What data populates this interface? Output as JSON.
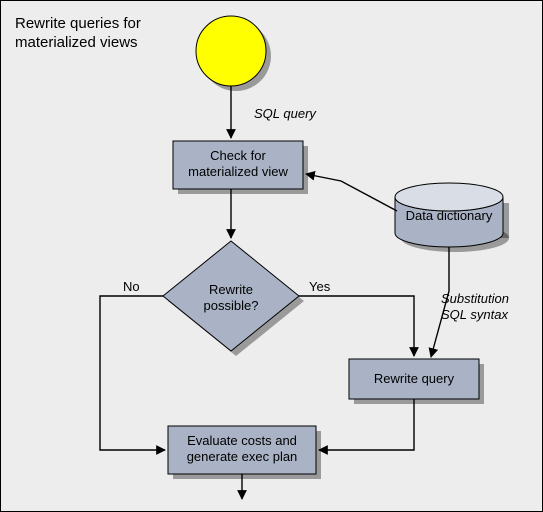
{
  "title": "Rewrite queries for\nmaterialized views",
  "nodes": {
    "start": {
      "name": "start-node"
    },
    "check": {
      "label": "Check for\nmaterialized view"
    },
    "decision": {
      "label": "Rewrite\npossible?"
    },
    "rewrite": {
      "label": "Rewrite query"
    },
    "evaluate": {
      "label": "Evaluate costs and\ngenerate exec plan"
    },
    "dict": {
      "label": "Data dictionary"
    }
  },
  "edges": {
    "sql_query": {
      "label": "SQL query"
    },
    "substitution": {
      "label": "Substitution\nSQL syntax"
    },
    "yes": {
      "label": "Yes"
    },
    "no": {
      "label": "No"
    }
  },
  "chart_data": {
    "type": "diagram",
    "title": "Rewrite queries for materialized views",
    "nodes": [
      {
        "id": "start",
        "type": "start",
        "label": ""
      },
      {
        "id": "check",
        "type": "process",
        "label": "Check for materialized view"
      },
      {
        "id": "decision",
        "type": "decision",
        "label": "Rewrite possible?"
      },
      {
        "id": "rewrite",
        "type": "process",
        "label": "Rewrite query"
      },
      {
        "id": "evaluate",
        "type": "process",
        "label": "Evaluate costs and generate exec plan"
      },
      {
        "id": "dict",
        "type": "datastore",
        "label": "Data dictionary"
      },
      {
        "id": "end",
        "type": "end",
        "label": ""
      }
    ],
    "edges": [
      {
        "from": "start",
        "to": "check",
        "label": "SQL query"
      },
      {
        "from": "check",
        "to": "decision",
        "label": ""
      },
      {
        "from": "decision",
        "to": "rewrite",
        "label": "Yes"
      },
      {
        "from": "decision",
        "to": "evaluate",
        "label": "No"
      },
      {
        "from": "rewrite",
        "to": "evaluate",
        "label": ""
      },
      {
        "from": "dict",
        "to": "check",
        "label": ""
      },
      {
        "from": "dict",
        "to": "rewrite",
        "label": "Substitution SQL syntax"
      },
      {
        "from": "evaluate",
        "to": "end",
        "label": ""
      }
    ]
  }
}
